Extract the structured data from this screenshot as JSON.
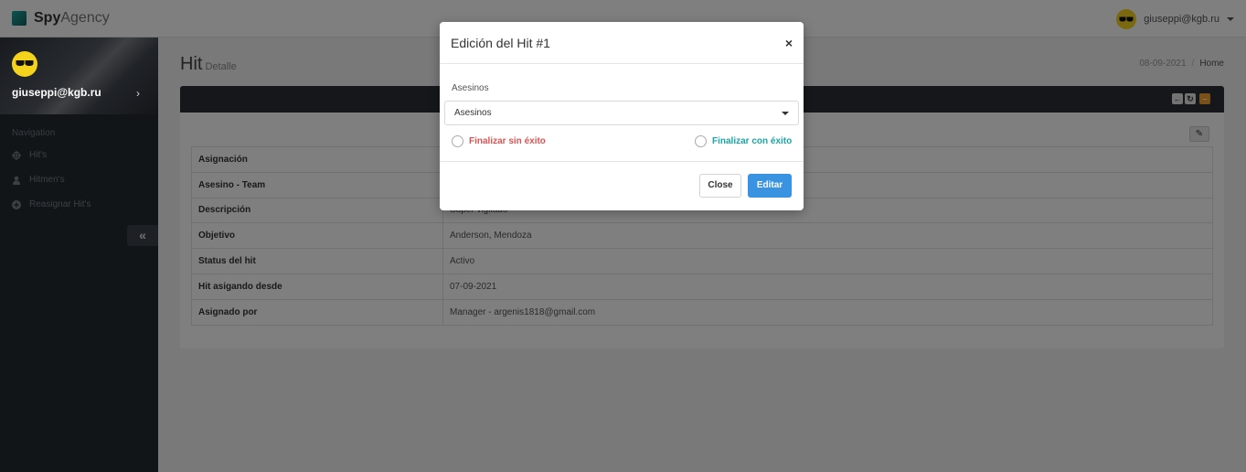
{
  "app": {
    "brand_bold": "Spy",
    "brand_light": "Agency",
    "user_email": "giuseppi@kgb.ru",
    "accent_color": "#3a93e1"
  },
  "sidebar": {
    "user": "giuseppi@kgb.ru",
    "nav_title": "Navigation",
    "items": [
      {
        "label": "Hit's",
        "icon": "crosshair-icon"
      },
      {
        "label": "Hitmen's",
        "icon": "person-icon"
      },
      {
        "label": "Reasignar Hit's",
        "icon": "plus-circle-icon"
      }
    ],
    "collapse_glyph": "«"
  },
  "page": {
    "title": "Hit",
    "subtitle": "Detalle",
    "breadcrumb_date": "08-09-2021",
    "breadcrumb_sep": "/",
    "breadcrumb_home": "Home"
  },
  "detail_table": [
    {
      "key": "Asignación",
      "value": ""
    },
    {
      "key": "Asesino - Team",
      "value": ""
    },
    {
      "key": "Descripción",
      "value": "Super vigilado"
    },
    {
      "key": "Objetivo",
      "value": "Anderson, Mendoza"
    },
    {
      "key": "Status del hit",
      "value": "Activo"
    },
    {
      "key": "Hit asigando desde",
      "value": "07-09-2021"
    },
    {
      "key": "Asignado por",
      "value": "Manager - argenis1818@gmail.com"
    }
  ],
  "modal": {
    "title": "Edición del Hit #1",
    "close_glyph": "×",
    "field_label": "Asesinos",
    "select_value": "Asesinos",
    "radio_fail_label": "Finalizar sin éxito",
    "radio_fail_color": "#e05252",
    "radio_success_label": "Finalizar con éxito",
    "radio_success_color": "#1aa6a6",
    "close_button": "Close",
    "edit_button": "Editar"
  }
}
